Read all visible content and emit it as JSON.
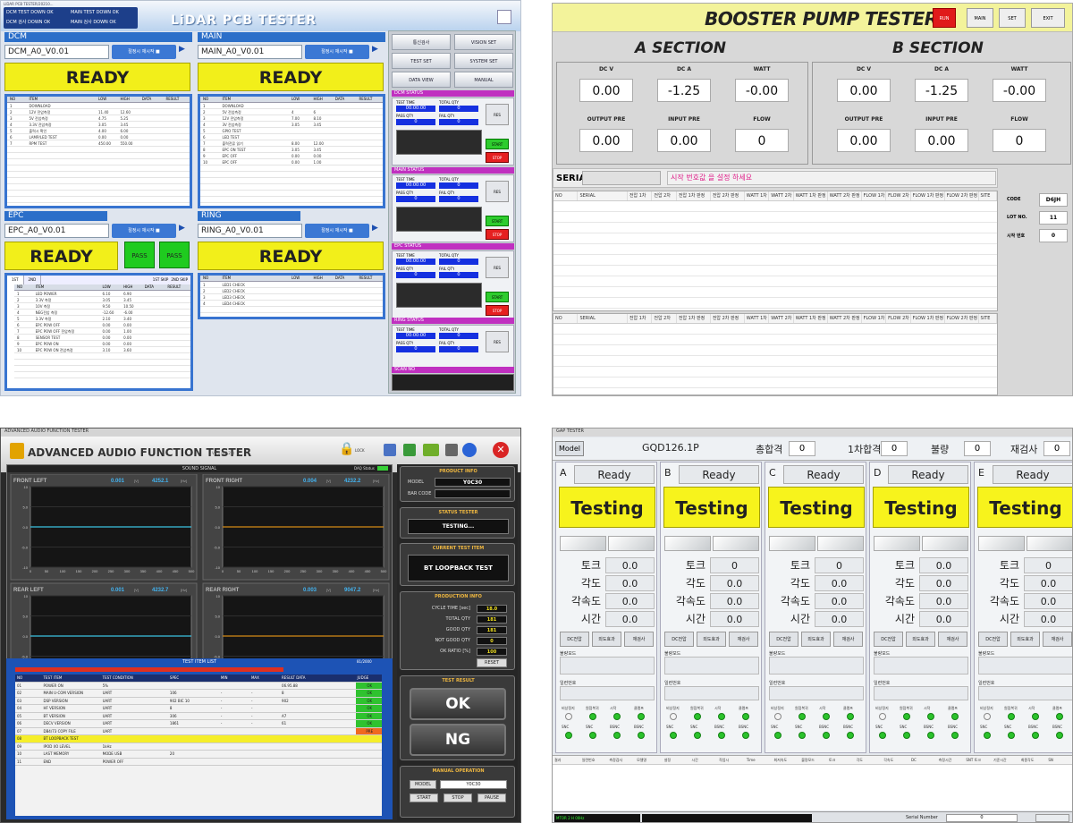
{
  "panelA": {
    "window_title": "LIDAR PCB TESTER/20210...",
    "title": "LiDAR PCB TESTER",
    "status_lines": [
      "DCM TEST DOWN OK",
      "MAIN TEST DOWN OK",
      "DCM 검사 DOWN OK",
      "MAIN 검사 DOWN OK"
    ],
    "sections": [
      {
        "name": "DCM",
        "combo": "DCM_A0_V0.01",
        "button": "절정시 재시작 ■",
        "ready": "READY"
      },
      {
        "name": "MAIN",
        "combo": "MAIN_A0_V0.01",
        "button": "절정시 재시작 ■",
        "ready": "READY"
      },
      {
        "name": "EPC",
        "combo": "EPC_A0_V0.01",
        "button": "절정시 재시작 ■",
        "ready": "READY",
        "pass": [
          "PASS",
          "PASS"
        ]
      },
      {
        "name": "RING",
        "combo": "RING_A0_V0.01",
        "button": "절정시 재시작 ■",
        "ready": "READY"
      }
    ],
    "table_headers": [
      "NO",
      "ITEM",
      "LOW",
      "HIGH",
      "DATA",
      "RESULT"
    ],
    "dcm_rows": [
      [
        "1",
        "DOWNLOAD",
        "",
        "",
        "",
        ""
      ],
      [
        "2",
        "12V 전압측정",
        "11.40",
        "12.60",
        "",
        ""
      ],
      [
        "3",
        "5V 전압측정",
        "4.75",
        "5.25",
        "",
        ""
      ],
      [
        "4",
        "3.3V 전압측정",
        "3.05",
        "3.45",
        "",
        ""
      ],
      [
        "5",
        "출력시 확인",
        "4.00",
        "6.00",
        "",
        ""
      ],
      [
        "6",
        "LAMP/LED TEST",
        "0.00",
        "0.00",
        "",
        ""
      ],
      [
        "7",
        "RPM TEST",
        "450.00",
        "550.00",
        "",
        ""
      ]
    ],
    "main_rows": [
      [
        "1",
        "DOWNLOAD",
        "",
        "",
        "",
        ""
      ],
      [
        "2",
        "5V 전압측정",
        "4",
        "6",
        "",
        ""
      ],
      [
        "3",
        "12V 전압측정",
        "7.00",
        "8.10",
        "",
        ""
      ],
      [
        "4",
        "3V 전압측정",
        "3.05",
        "3.45",
        "",
        ""
      ],
      [
        "5",
        "GPIO TEST",
        "",
        "",
        "",
        ""
      ],
      [
        "6",
        "LED TEST",
        "",
        "",
        "",
        ""
      ],
      [
        "7",
        "출력전류 읽기",
        "8.00",
        "12.00",
        "",
        ""
      ],
      [
        "8",
        "EPC ON TEST",
        "3.05",
        "3.45",
        "",
        ""
      ],
      [
        "9",
        "EPC OFF",
        "0.00",
        "0.00",
        "",
        ""
      ],
      [
        "10",
        "EPC OFF",
        "0.00",
        "1.00",
        "",
        ""
      ]
    ],
    "epc_tabs": [
      "1ST",
      "2ND"
    ],
    "epc_checks": [
      "1ST SKIP",
      "2ND SKIP"
    ],
    "epc_rows": [
      [
        "1",
        "LED POWER",
        "6.10",
        "6.90",
        "",
        ""
      ],
      [
        "2",
        "3.3V 측정",
        "3.05",
        "3.45",
        "",
        ""
      ],
      [
        "3",
        "10V 측정",
        "9.50",
        "10.50",
        "",
        ""
      ],
      [
        "4",
        "NEG전압 측정",
        "-12.60",
        "-6.00",
        "",
        ""
      ],
      [
        "5",
        "3.3V 측정",
        "2.10",
        "3.40",
        "",
        ""
      ],
      [
        "6",
        "EPC POW OFF",
        "0.00",
        "0.00",
        "",
        ""
      ],
      [
        "7",
        "EPC POW OFF 전압측정",
        "0.00",
        "1.00",
        "",
        ""
      ],
      [
        "8",
        "SENSOR TEST",
        "0.00",
        "0.00",
        "",
        ""
      ],
      [
        "9",
        "EPC POW ON",
        "0.00",
        "0.00",
        "",
        ""
      ],
      [
        "10",
        "EPC POW ON 전압측정",
        "3.10",
        "3.60",
        "",
        ""
      ]
    ],
    "ring_rows": [
      [
        "1",
        "LED1 CHECK",
        "",
        "",
        "",
        ""
      ],
      [
        "2",
        "LED2 CHECK",
        "",
        "",
        "",
        ""
      ],
      [
        "3",
        "LED3 CHECK",
        "",
        "",
        "",
        ""
      ],
      [
        "4",
        "LED4 CHECK",
        "",
        "",
        "",
        ""
      ]
    ],
    "tools": [
      "통신검사",
      "VISION SET",
      "TEST SET",
      "SYSTEM SET",
      "DATA VIEW",
      "MANUAL"
    ],
    "status_titles": [
      "DCM STATUS",
      "MAIN STATUS",
      "EPC STATUS",
      "RING STATUS",
      "SCAN NO"
    ],
    "status_labels": [
      "TEST TIME",
      "TOTAL QTY",
      "PASS QTY",
      "FAIL QTY",
      "RES"
    ],
    "status_time": "00:00:00",
    "status_count": "0",
    "start_label": "START",
    "stop_label": "STOP"
  },
  "panelB": {
    "title": "BOOSTER PUMP TESTER",
    "top_buttons": [
      "RUN",
      "MAIN",
      "SET",
      "EXIT"
    ],
    "sections": [
      {
        "name": "A SECTION",
        "labels": [
          "DC V",
          "DC A",
          "WATT",
          "OUTPUT PRE",
          "INPUT PRE",
          "FLOW"
        ],
        "values": [
          "0.00",
          "-1.25",
          "-0.00",
          "0.00",
          "0.00",
          "0"
        ]
      },
      {
        "name": "B SECTION",
        "labels": [
          "DC V",
          "DC A",
          "WATT",
          "OUTPUT PRE",
          "INPUT PRE",
          "FLOW"
        ],
        "values": [
          "0.00",
          "-1.25",
          "-0.00",
          "0.00",
          "0.00",
          "0"
        ]
      }
    ],
    "serial_label": "SERIAL",
    "message": "시작 번호값 을 설정 하세요",
    "grid_headers": [
      "NO",
      "SERIAL",
      "전압 1차",
      "전압 2차",
      "전압 1차 판정",
      "전압 2차 판정",
      "WATT 1차",
      "WATT 2차",
      "WATT 1차 판정",
      "WATT 2차 판정",
      "FLOW 1차",
      "FLOW 2차",
      "FLOW 1차 판정",
      "FLOW 2차 판정",
      "SITE"
    ],
    "side": [
      {
        "label": "CODE",
        "value": "D6JH"
      },
      {
        "label": "LOT NO.",
        "value": "11"
      },
      {
        "label": "시작 번호",
        "value": "0"
      }
    ]
  },
  "panelC": {
    "window_title": "ADVANCED AUDIO FUNCTION TESTER",
    "title": "ADVANCED AUDIO FUNCTION TESTER",
    "version": "V1.0 (06.21)",
    "lock_label": "LOCK",
    "sound_signal": "SOUND SIGNAL",
    "daq_status": "DAQ Status",
    "charts": [
      {
        "name": "FRONT LEFT",
        "v1": "0.001",
        "v2": "4252.1",
        "color": "#3bc2e0"
      },
      {
        "name": "FRONT RIGHT",
        "v1": "0.004",
        "v2": "4232.2",
        "color": "#d48a16"
      },
      {
        "name": "REAR LEFT",
        "v1": "0.001",
        "v2": "4232.7",
        "color": "#3bc2e0"
      },
      {
        "name": "REAR RIGHT",
        "v1": "0.003",
        "v2": "9047.2",
        "color": "#d48a16"
      }
    ],
    "chart_data": {
      "type": "line",
      "x": [
        0,
        50,
        100,
        150,
        200,
        250,
        300,
        350,
        400,
        450,
        500
      ],
      "ylim": [
        -10,
        10
      ],
      "series": [
        {
          "name": "FRONT LEFT",
          "values": [
            0,
            0,
            0,
            0,
            0,
            0,
            0,
            0,
            0,
            0,
            0
          ]
        },
        {
          "name": "FRONT RIGHT",
          "values": [
            0,
            0,
            0,
            0,
            0,
            0,
            0,
            0,
            0,
            0,
            0
          ]
        },
        {
          "name": "REAR LEFT",
          "values": [
            0,
            0,
            0,
            0,
            0,
            0,
            0,
            0,
            0,
            0,
            0
          ]
        },
        {
          "name": "REAR RIGHT",
          "values": [
            0,
            0,
            0,
            0,
            0,
            0,
            0,
            0,
            0,
            0,
            0
          ]
        }
      ]
    },
    "unit_v": "[V]",
    "unit_hz": "[Hz]",
    "y_ticks": [
      "10",
      "5.0",
      "0.0",
      "-5.0",
      "-10"
    ],
    "x_ticks": [
      "0",
      "50",
      "100",
      "150",
      "200",
      "250",
      "300",
      "350",
      "400",
      "450",
      "500"
    ],
    "test_item_list": "TEST ITEM LIST",
    "test_count": "81/2000",
    "table_headers": [
      "NO",
      "TEST ITEM",
      "TEST CONDITION",
      "SPEC",
      "MIN",
      "MAX",
      "RESULT DATA",
      "JUDGE"
    ],
    "rows": [
      [
        "01",
        "POWER ON",
        "5%",
        "",
        "",
        "",
        "06.95.88",
        "OK"
      ],
      [
        "02",
        "MAIN U-COM VERSION",
        "UART",
        "106",
        "-",
        "-",
        "8",
        "OK"
      ],
      [
        "03",
        "DSP VERSION",
        "UART",
        "902 BIC 10",
        "-",
        "-",
        "902",
        "OK"
      ],
      [
        "04",
        "HF VERSION",
        "UART",
        "8",
        "-",
        "-",
        "",
        "OK"
      ],
      [
        "05",
        "BT VERSION",
        "UART",
        "306",
        "-",
        "-",
        "A7",
        "OK"
      ],
      [
        "06",
        "DECV VERSION",
        "UART",
        "1861",
        "-",
        "-",
        "61",
        "OK"
      ],
      [
        "07",
        "DB4/73 COPY FILE",
        "UART",
        "",
        "",
        "",
        "",
        "PRE"
      ],
      [
        "08",
        "BT LOOPBACK TEST",
        "",
        "",
        "",
        "",
        "",
        ""
      ],
      [
        "09",
        "IPOD I/O LEVEL",
        "1kHz",
        "",
        "",
        "",
        "",
        ""
      ],
      [
        "10",
        "LAST MEMORY",
        "MODE USB",
        "20",
        "",
        "",
        "",
        ""
      ],
      [
        "11",
        "END",
        "POWER OFF",
        "",
        "",
        "",
        "",
        ""
      ]
    ],
    "product_info": "PRODUCT INFO",
    "model_label": "MODEL",
    "model_value": "Y0C30",
    "barcode_label": "BAR CODE",
    "status_tester": "STATUS TESTER",
    "status_value": "TESTING...",
    "current_item": "CURRENT TEST ITEM",
    "current_value": "BT LOOPBACK TEST",
    "production_info": "PRODUCTION INFO",
    "production": [
      {
        "label": "CYCLE TIME [sec]",
        "value": "18.0"
      },
      {
        "label": "TOTAL QTY",
        "value": "181"
      },
      {
        "label": "GOOD QTY",
        "value": "181"
      },
      {
        "label": "NOT GOOD QTY",
        "value": "0"
      },
      {
        "label": "OK RATIO [%]",
        "value": "100"
      }
    ],
    "reset_label": "RESET",
    "test_result": "TEST RESULT",
    "ok_label": "OK",
    "ng_label": "NG",
    "manual_op": "MANUAL OPERATION",
    "model_btn": "MODEL",
    "manual_model": "Y0C30",
    "manual_btns": [
      "START",
      "STOP",
      "PAUSE"
    ]
  },
  "panelD": {
    "window_title": "GAP TESTER",
    "model_btn": "Model",
    "model": "GQD126.1P",
    "totals": [
      {
        "label": "총합격",
        "value": "0"
      },
      {
        "label": "1차합격",
        "value": "0"
      },
      {
        "label": "불량",
        "value": "0"
      },
      {
        "label": "재검사",
        "value": "0"
      }
    ],
    "stations": [
      {
        "letter": "A",
        "status": "Ready",
        "state": "Testing",
        "values": [
          "0.0",
          "0.0",
          "0.0",
          "0.0"
        ]
      },
      {
        "letter": "B",
        "status": "Ready",
        "state": "Testing",
        "values": [
          "0",
          "0.0",
          "0.0",
          "0.0"
        ]
      },
      {
        "letter": "C",
        "status": "Ready",
        "state": "Testing",
        "values": [
          "0",
          "0.0",
          "0.0",
          "0.0"
        ]
      },
      {
        "letter": "D",
        "status": "Ready",
        "state": "Testing",
        "values": [
          "0.0",
          "0.0",
          "0.0",
          "0.0"
        ]
      },
      {
        "letter": "E",
        "status": "Ready",
        "state": "Testing",
        "values": [
          "0",
          "0.0",
          "0.0",
          "0.0"
        ]
      }
    ],
    "labels": [
      "토크",
      "각도",
      "각속도",
      "시간"
    ],
    "small_btns": [
      "DC전압",
      "외도효과",
      "재검사"
    ],
    "defect_label": "불량모드",
    "serial_label": "일련번호",
    "led_labels": [
      "비상정지",
      "원점복귀",
      "시작",
      "클램프"
    ],
    "led_labels2": [
      "SNC",
      "SNC",
      "BSNC",
      "BSNC"
    ],
    "bottom_headers": [
      "결과",
      "일련번호",
      "측정검사",
      "모델명",
      "설정",
      "시간",
      "작업시",
      "Time",
      "최저속도",
      "불량모드",
      "토크",
      "각도",
      "각속도",
      "DC",
      "측정시간",
      "SNT 토크",
      "기준시간",
      "최종각도",
      "SN"
    ],
    "serial_number_label": "Serial Number",
    "serial_number_value": "0",
    "status_left": "MTOR 2 H 00Hz"
  }
}
